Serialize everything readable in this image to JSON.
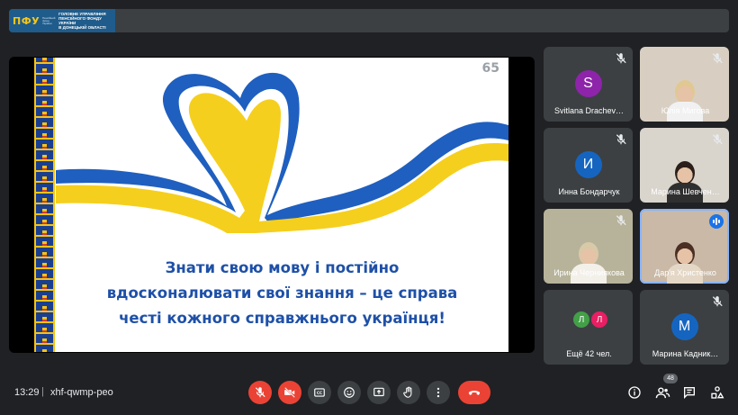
{
  "banner": {
    "logo_mark": "ПФУ",
    "logo_sub": "Пенсійний фонд України",
    "org_lines": [
      "ГОЛОВНЕ УПРАВЛІННЯ",
      "ПЕНСІЙНОГО ФОНДУ УКРАЇНИ",
      "В ДОНЕЦЬКІЙ ОБЛАСТІ"
    ]
  },
  "presentation": {
    "slide_number": "65",
    "quote_lines": [
      "Знати свою мову і постійно",
      "вдосконалювати свої знання – це справа",
      "честі кожного справжнього українця!"
    ],
    "colors": {
      "blue": "#1f5fbf",
      "yellow": "#f5cf1d"
    }
  },
  "participants": [
    {
      "name": "Svitlana Drachev…",
      "initial": "S",
      "avatar_color": "#8e24aa",
      "type": "avatar",
      "muted": true
    },
    {
      "name": "Юлія Мигова",
      "type": "video",
      "muted": true,
      "bg": "#d8cfc2",
      "hair": "#e1c893",
      "shirt": "#f1f1f1"
    },
    {
      "name": "Инна Бондарчук",
      "initial": "И",
      "avatar_color": "#1565c0",
      "type": "avatar",
      "muted": true
    },
    {
      "name": "Марина Шевчен…",
      "type": "video",
      "muted": true,
      "bg": "#d9d4cc",
      "hair": "#2b1f1a",
      "shirt": "#2f2f2f"
    },
    {
      "name": "Ирина Черниякова",
      "type": "video",
      "muted": true,
      "bg": "#b7b39a",
      "hair": "#d8c9a8",
      "shirt": "#f3f0ea"
    },
    {
      "name": "Дар'я Христенко",
      "type": "video",
      "muted": false,
      "speaking": true,
      "bg": "#c9b9a6",
      "hair": "#4a2f22",
      "shirt": "#e4d7c5"
    },
    {
      "name": "Ещё 42 чел.",
      "type": "more",
      "avatars": [
        {
          "initial": "Л",
          "color": "#43a047"
        },
        {
          "initial": "Л",
          "color": "#e91e63"
        }
      ]
    },
    {
      "name": "Марина Кадник…",
      "initial": "M",
      "avatar_color": "#1565c0",
      "type": "avatar",
      "muted": true
    }
  ],
  "bottom_bar": {
    "time": "13:29",
    "separator": "|",
    "meeting_code": "xhf-qwmp-peo",
    "controls": [
      "mic-off-icon",
      "camera-off-icon",
      "captions-icon",
      "emoji-icon",
      "present-icon",
      "raise-hand-icon",
      "more-options-icon",
      "end-call-icon"
    ],
    "right_icons": [
      "info-icon",
      "people-icon",
      "chat-icon",
      "activities-icon"
    ],
    "participant_count": "48"
  }
}
